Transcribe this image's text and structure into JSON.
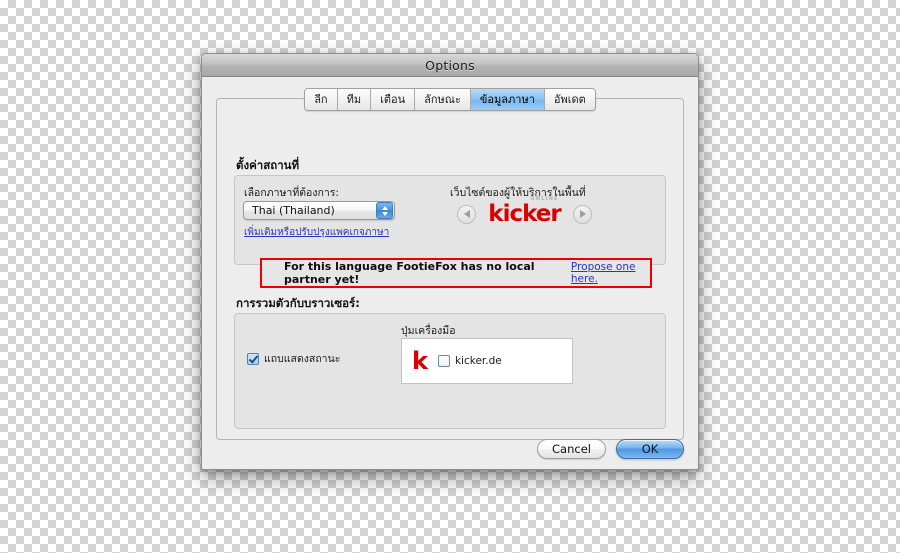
{
  "window": {
    "title": "Options"
  },
  "tabs": [
    {
      "label": "ลีก",
      "selected": false
    },
    {
      "label": "ทีม",
      "selected": false
    },
    {
      "label": "เตือน",
      "selected": false
    },
    {
      "label": "ลักษณะ",
      "selected": false
    },
    {
      "label": "ข้อมูลภาษา",
      "selected": true
    },
    {
      "label": "อัพเดต",
      "selected": false
    }
  ],
  "location_section": {
    "title": "ตั้งค่าสถานที่",
    "language_label": "เลือกภาษาที่ต้องการ:",
    "language_value": "Thai (Thailand)",
    "language_link": "เพิ่มเติมหรือปรับปรุงแพคเกจภาษา",
    "provider_label": "เว็บไซต์ของผู้ให้บริการในพื้นที่",
    "provider_logo_word": "kicker",
    "provider_logo_sup": "ONLINE",
    "prev_icon": "chevron-left-icon",
    "next_icon": "chevron-right-icon"
  },
  "warning": {
    "text": "For this language FootieFox has no local partner yet!",
    "link": "Propose one here.",
    "border_color": "#ee0000"
  },
  "browser_section": {
    "title": "การรวมตัวกับบราวเซอร์:",
    "statusbar_label": "แถบแสดงสถานะ",
    "statusbar_checked": "true",
    "toolbar_label": "ปุ่มเครื่องมือ",
    "toolbar_logo": "k",
    "toolbar_item_label": "kicker.de",
    "toolbar_item_checked": "false"
  },
  "footer": {
    "cancel_label": "Cancel",
    "ok_label": "OK"
  },
  "colors": {
    "brand_red": "#dd0000",
    "link_blue": "#2c35bb",
    "tab_selected_blue": "#8cc4f2",
    "default_button_blue": "#4f97e2"
  }
}
